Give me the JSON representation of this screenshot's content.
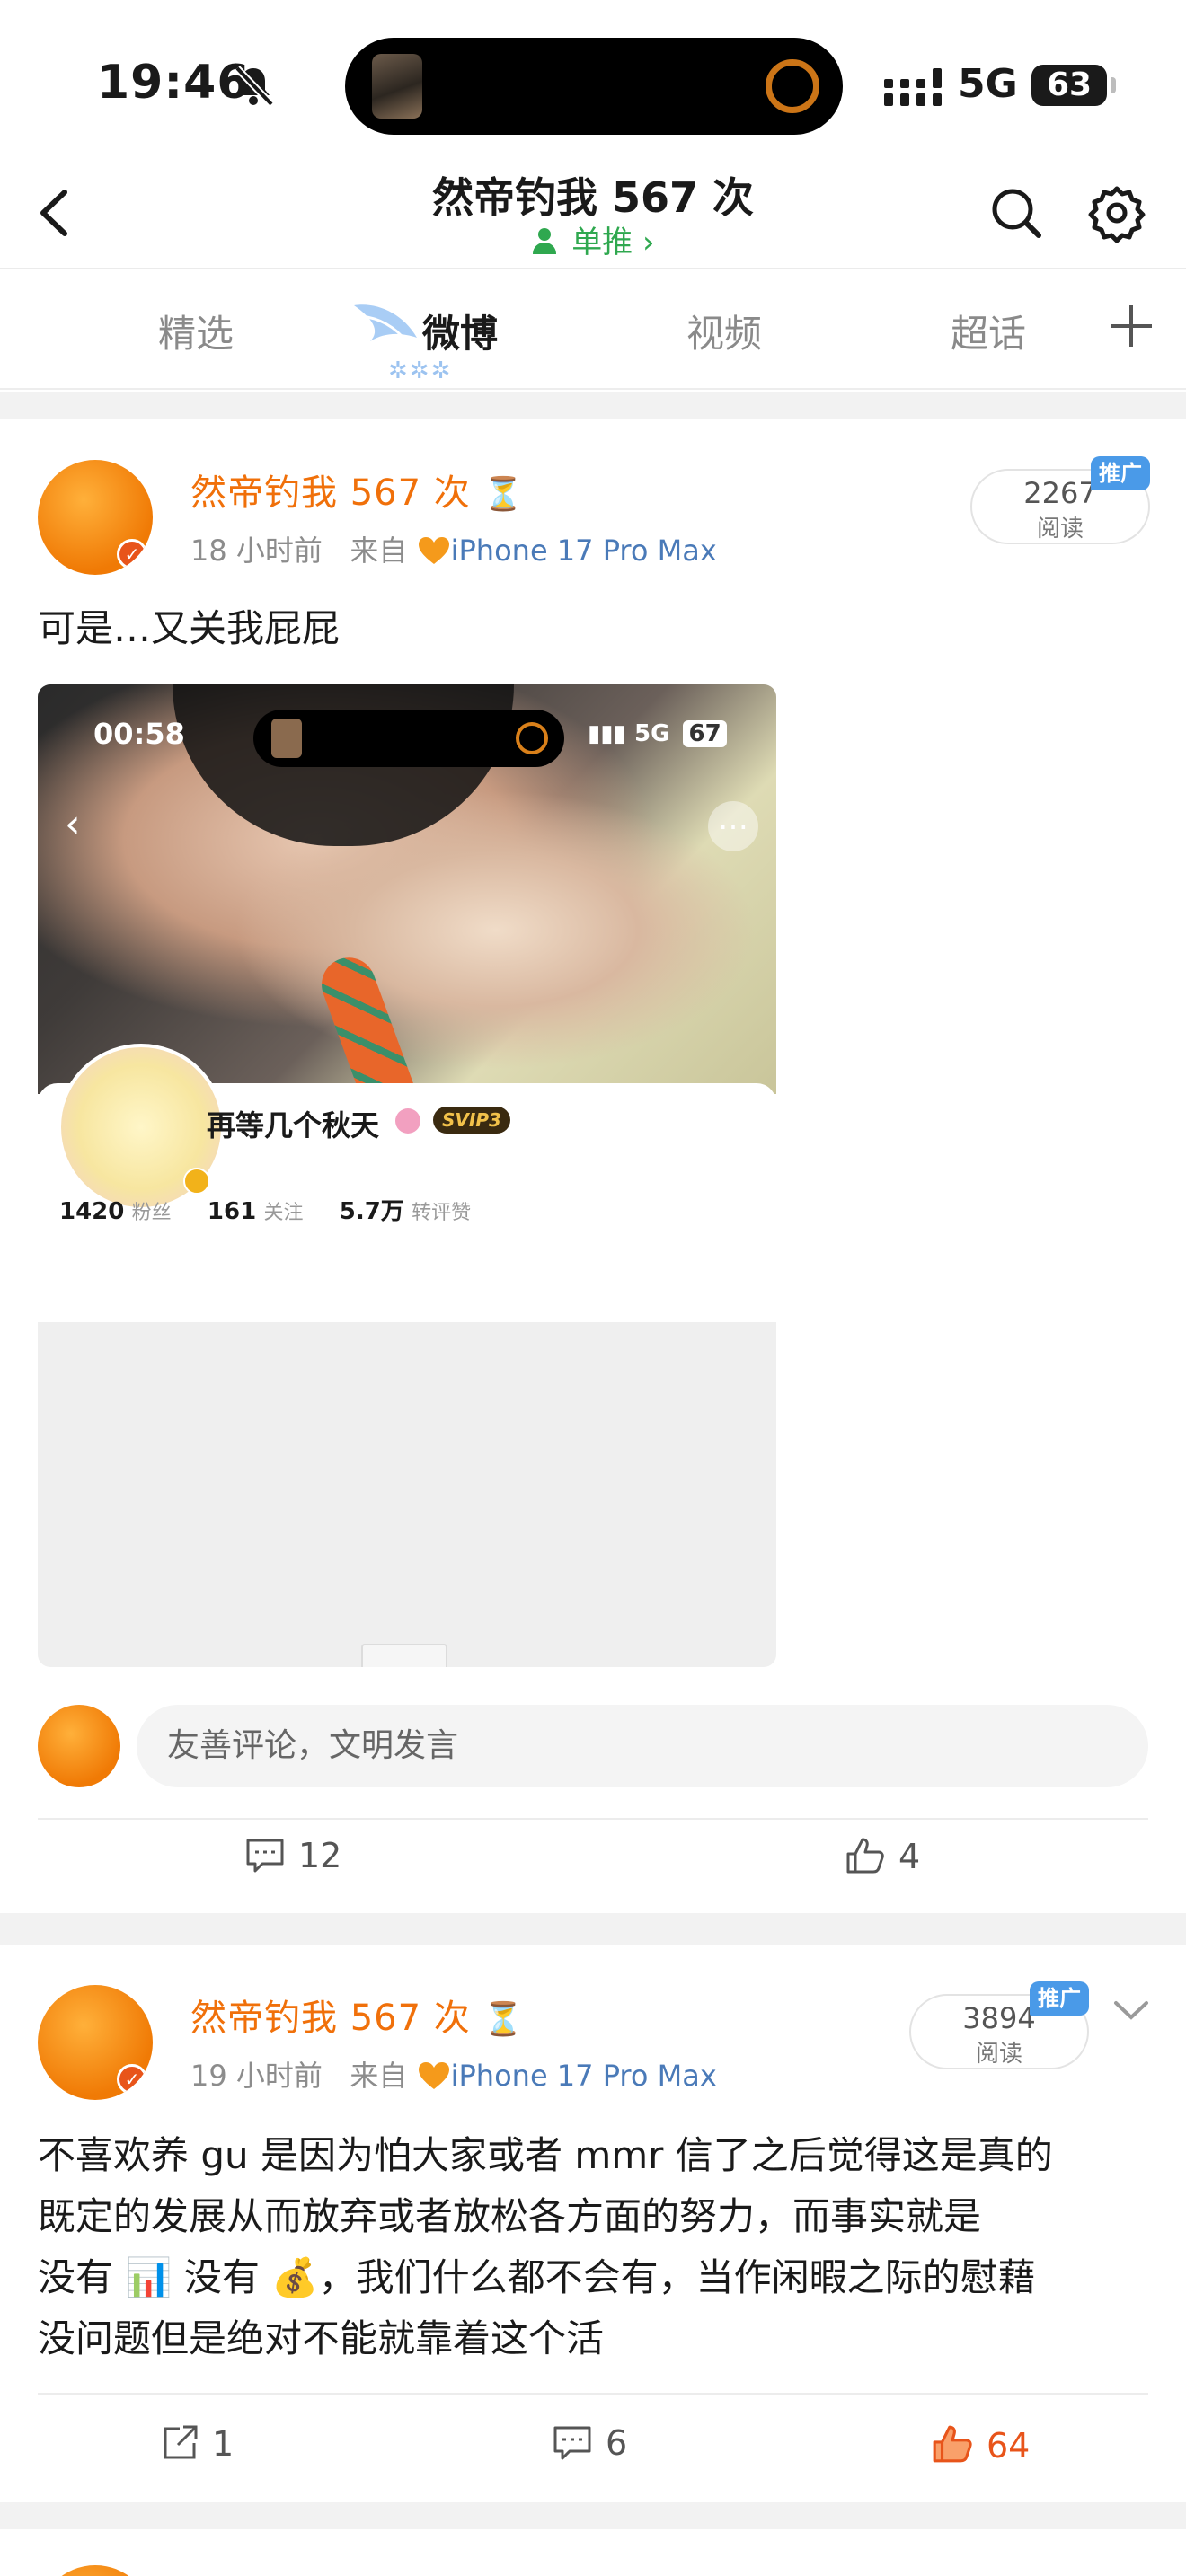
{
  "status_bar": {
    "time": "19:46",
    "network": "5G",
    "battery": "63"
  },
  "nav": {
    "title": "然帝钓我 567 次",
    "subtitle": "单推",
    "icons": [
      "back-arrow-icon",
      "search-icon",
      "settings-gear-icon"
    ]
  },
  "tabs": {
    "items": [
      {
        "label": "精选"
      },
      {
        "label": "微博"
      },
      {
        "label": "视频"
      },
      {
        "label": "超话"
      }
    ],
    "active": "微博",
    "add_icon": "plus-icon"
  },
  "colors": {
    "username": "#f0700a",
    "liked": "#e8541a",
    "subtitle_green": "#2fa84f",
    "promo_blue": "#4a9ae8"
  },
  "posts": [
    {
      "author": "然帝钓我 567 次",
      "author_badge": "⏳",
      "time": "18 小时前",
      "source_prefix": "来自",
      "source": "iPhone 17 Pro Max",
      "reads": "2267",
      "reads_label": "阅读",
      "promo": "推广",
      "text": "可是…又关我屁屁",
      "screenshot": {
        "time": "00:58",
        "signal": "5G",
        "battery": "67",
        "profile_name": "再等几个秋天",
        "vip": "SVIP3",
        "followers": "1420",
        "followers_label": "粉丝",
        "following": "161",
        "following_label": "关注",
        "likes": "5.7万",
        "likes_label": "转评赞"
      },
      "comment_placeholder": "友善评论，文明发言",
      "comments": "12",
      "likes": "4"
    },
    {
      "author": "然帝钓我 567 次",
      "author_badge": "⏳",
      "time": "19 小时前",
      "source_prefix": "来自",
      "source": "iPhone 17 Pro Max",
      "reads": "3894",
      "reads_label": "阅读",
      "promo": "推广",
      "text_line1": "不喜欢养 gu 是因为怕大家或者 mmr 信了之后觉得这是真的",
      "text_line2": "既定的发展从而放弃或者放松各方面的努力，而事实就是",
      "text_line3": "没有 📊 没有 💰，我们什么都不会有，当作闲暇之际的慰藉",
      "text_line4": "没问题但是绝对不能就靠着这个活",
      "reposts": "1",
      "comments": "6",
      "likes": "64"
    }
  ]
}
